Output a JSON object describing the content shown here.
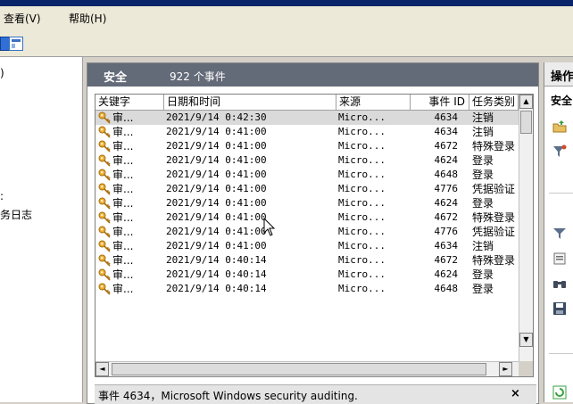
{
  "menubar": {
    "view": "查看(V)",
    "help": "帮助(H)"
  },
  "left_tree": {
    "fragment_top": ")",
    "fragment_mid": ":",
    "fragment_log": "务日志"
  },
  "center": {
    "log_name": "安全",
    "event_count": "922 个事件",
    "columns": {
      "keyword": "关键字",
      "datetime": "日期和时间",
      "source": "来源",
      "event_id": "事件 ID",
      "category": "任务类别"
    },
    "rows": [
      {
        "keyword": "审...",
        "datetime": "2021/9/14 0:42:30",
        "source": "Micro...",
        "event_id": "4634",
        "category": "注销"
      },
      {
        "keyword": "审...",
        "datetime": "2021/9/14 0:41:00",
        "source": "Micro...",
        "event_id": "4634",
        "category": "注销"
      },
      {
        "keyword": "审...",
        "datetime": "2021/9/14 0:41:00",
        "source": "Micro...",
        "event_id": "4672",
        "category": "特殊登录"
      },
      {
        "keyword": "审...",
        "datetime": "2021/9/14 0:41:00",
        "source": "Micro...",
        "event_id": "4624",
        "category": "登录"
      },
      {
        "keyword": "审...",
        "datetime": "2021/9/14 0:41:00",
        "source": "Micro...",
        "event_id": "4648",
        "category": "登录"
      },
      {
        "keyword": "审...",
        "datetime": "2021/9/14 0:41:00",
        "source": "Micro...",
        "event_id": "4776",
        "category": "凭据验证"
      },
      {
        "keyword": "审...",
        "datetime": "2021/9/14 0:41:00",
        "source": "Micro...",
        "event_id": "4624",
        "category": "登录"
      },
      {
        "keyword": "审...",
        "datetime": "2021/9/14 0:41:00",
        "source": "Micro...",
        "event_id": "4672",
        "category": "特殊登录"
      },
      {
        "keyword": "审...",
        "datetime": "2021/9/14 0:41:00",
        "source": "Micro...",
        "event_id": "4776",
        "category": "凭据验证"
      },
      {
        "keyword": "审...",
        "datetime": "2021/9/14 0:41:00",
        "source": "Micro...",
        "event_id": "4634",
        "category": "注销"
      },
      {
        "keyword": "审...",
        "datetime": "2021/9/14 0:40:14",
        "source": "Micro...",
        "event_id": "4672",
        "category": "特殊登录"
      },
      {
        "keyword": "审...",
        "datetime": "2021/9/14 0:40:14",
        "source": "Micro...",
        "event_id": "4624",
        "category": "登录"
      },
      {
        "keyword": "审...",
        "datetime": "2021/9/14 0:40:14",
        "source": "Micro...",
        "event_id": "4648",
        "category": "登录"
      }
    ],
    "detail_title": "事件 4634，Microsoft Windows security auditing.",
    "detail_close": "×"
  },
  "actions": {
    "title": "操作",
    "section": "安全"
  },
  "scroll": {
    "up": "▲",
    "down": "▼",
    "left": "◄",
    "right": "►"
  },
  "icons": {
    "row_icon": "key-icon",
    "actions": [
      "open-log-icon",
      "filter-icon",
      "filter-icon",
      "properties-icon",
      "find-icon",
      "save-icon",
      "refresh-icon"
    ]
  },
  "colors": {
    "header_bg": "#636a78",
    "selected_row": "#dadada",
    "key_gold": "#e0a020"
  }
}
